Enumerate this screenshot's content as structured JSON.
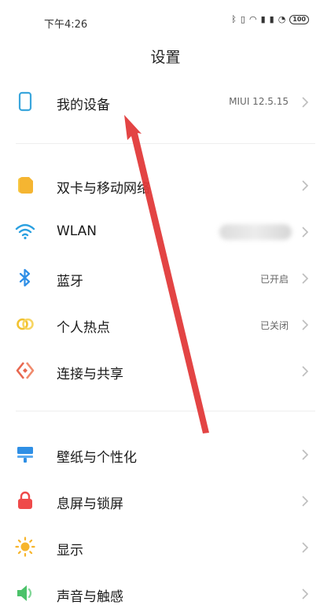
{
  "status_bar": {
    "time": "下午4:26",
    "icons": [
      "bluetooth-icon",
      "vibrate-icon",
      "nfc-icon",
      "signal-icon",
      "signal-icon",
      "wifi-icon",
      "battery-icon"
    ],
    "battery": "100"
  },
  "title": "设置",
  "items": [
    {
      "id": "my-device",
      "label": "我的设备",
      "value": "MIUI 12.5.15",
      "icon": "phone-icon",
      "color": "#3aa6dc"
    },
    {
      "id": "dual-sim",
      "label": "双卡与移动网络",
      "value": "",
      "icon": "sim-card-icon",
      "color": "#f5b531"
    },
    {
      "id": "wlan",
      "label": "WLAN",
      "value": "",
      "icon": "wifi-icon",
      "color": "#2aa0e0"
    },
    {
      "id": "bluetooth",
      "label": "蓝牙",
      "value": "已开启",
      "icon": "bluetooth-icon",
      "color": "#2d8ee6"
    },
    {
      "id": "hotspot",
      "label": "个人热点",
      "value": "已关闭",
      "icon": "hotspot-icon",
      "color": "#f2c230"
    },
    {
      "id": "connection-share",
      "label": "连接与共享",
      "value": "",
      "icon": "share-icon",
      "color": "#e8674f"
    },
    {
      "id": "wallpaper",
      "label": "壁纸与个性化",
      "value": "",
      "icon": "wallpaper-icon",
      "color": "#2f8fe5"
    },
    {
      "id": "lockscreen",
      "label": "息屏与锁屏",
      "value": "",
      "icon": "lock-icon",
      "color": "#ef4a4a"
    },
    {
      "id": "display",
      "label": "显示",
      "value": "",
      "icon": "sun-icon",
      "color": "#f7b52c"
    },
    {
      "id": "sound",
      "label": "声音与触感",
      "value": "",
      "icon": "speaker-icon",
      "color": "#4cc26a"
    }
  ],
  "annotation": {
    "color": "#e23a3a"
  }
}
